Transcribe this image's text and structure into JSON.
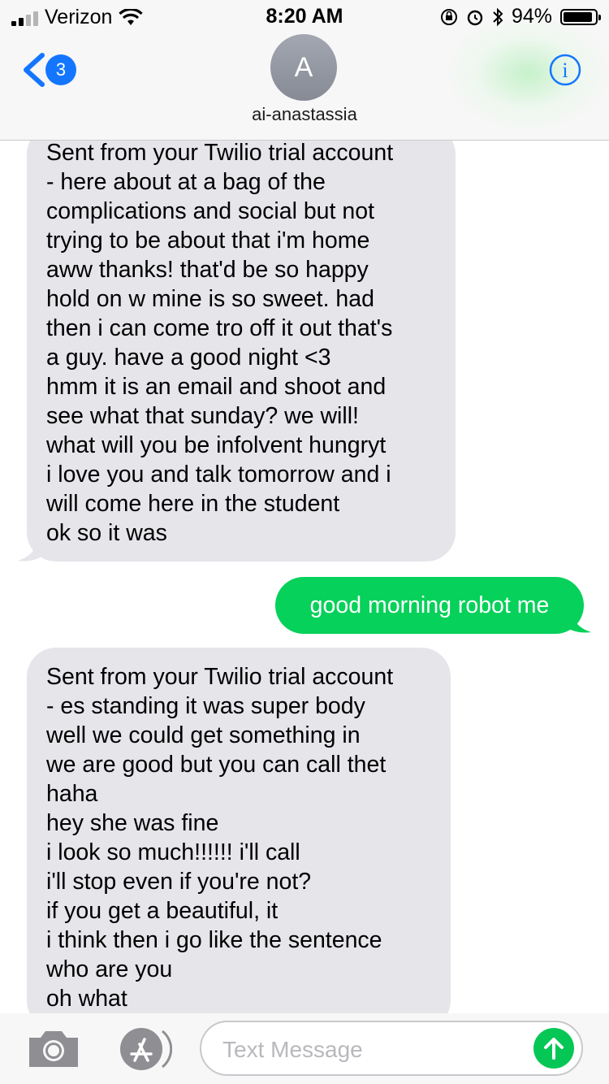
{
  "status_bar": {
    "carrier": "Verizon",
    "time": "8:20 AM",
    "battery": "94%",
    "battery_level": 0.94,
    "icons": [
      "signal-icon",
      "wifi-icon",
      "orientation-lock-icon",
      "alarm-icon",
      "bluetooth-icon",
      "battery-icon"
    ]
  },
  "header": {
    "back_count": "3",
    "avatar_initial": "A",
    "contact_name": "ai-anastassia",
    "info_label": "i"
  },
  "messages": [
    {
      "direction": "received",
      "lines": [
        "Sent from your Twilio trial account",
        "- here about at a bag of the",
        "complications and social but not",
        "trying to be about that i'm home",
        "aww thanks! that'd be so happy",
        "hold on w mine is so sweet. had",
        "then i can come tro off it out that's",
        "a guy. have a good night <3",
        "hmm it is an email and shoot and",
        "see what that sunday? we will!",
        "what will you be infolvent hungryt",
        "i love you and talk tomorrow and i",
        "will come here in the student",
        "ok so it was"
      ]
    },
    {
      "direction": "sent",
      "lines": [
        "good morning robot me"
      ]
    },
    {
      "direction": "received",
      "lines": [
        "Sent from your Twilio trial account",
        "- es standing it was super body",
        "well we could get something in",
        "we are good but you can call thet",
        "haha",
        "hey she was fine",
        "i look so much!!!!!! i'll call",
        "i'll stop even if you're not?",
        "if you get a beautiful, it",
        "i think then i go like the sentence",
        "who are you",
        "oh what"
      ]
    }
  ],
  "input_bar": {
    "placeholder": "Text Message",
    "value": ""
  },
  "colors": {
    "sent_bubble": "#06d15a",
    "received_bubble": "#e5e5ea",
    "accent": "#1476ff",
    "send_button": "#06c755"
  }
}
